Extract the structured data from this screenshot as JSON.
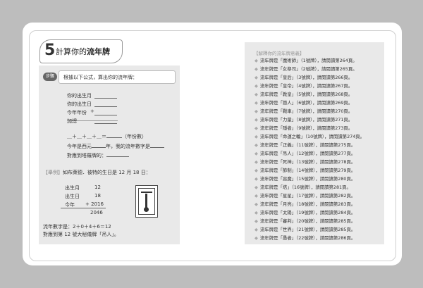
{
  "heading": {
    "number": "5",
    "text": "計算你的",
    "bold": "流年牌"
  },
  "step": {
    "badge": "步驟",
    "instruction": "根據以下公式，算出你的流年牌："
  },
  "form": {
    "birth_month": "你的出生月",
    "birth_day": "你的出生日",
    "this_year": "今年年份",
    "plus": "+",
    "add": "加總",
    "sum_formula_start": "＿＋＿＋＿＋＿＝",
    "sum_formula_end": "（年份數）",
    "result_pre": "今年是西元",
    "result_mid": "年，我的流年數字是",
    "mapping": "對應到塔羅牌的："
  },
  "example": {
    "label": "【舉例】",
    "text": "如布萊德．彼特的生日是 12 月 18 日：",
    "rows": [
      {
        "label": "出生月",
        "value": "12"
      },
      {
        "label": "出生日",
        "value": "18"
      },
      {
        "label": "今年",
        "value": "+ 2016"
      }
    ],
    "total": "2046",
    "conclusion1": "流年數字是：2＋0＋4＋6＝12",
    "conclusion2": "對應到第 12 號大秘儀牌「吊人」。"
  },
  "reference": {
    "title": "【解釋你的流年牌意義】",
    "items": [
      "流年牌是「魔術師」（1號牌），請閱讀第264頁。",
      "流年牌是「女祭司」（2號牌），請閱讀第265頁。",
      "流年牌是「皇后」（3號牌），請閱讀第266頁。",
      "流年牌是「皇帝」（4號牌），請閱讀第267頁。",
      "流年牌是「教皇」（5號牌），請閱讀第268頁。",
      "流年牌是「戀人」（6號牌），請閱讀第269頁。",
      "流年牌是「戰車」（7號牌），請閱讀第270頁。",
      "流年牌是「力量」（8號牌），請閱讀第271頁。",
      "流年牌是「隱者」（9號牌），請閱讀第273頁。",
      "流年牌是「命運之輪」（10號牌），請閱讀第274頁。",
      "流年牌是「正義」（11號牌），請閱讀第275頁。",
      "流年牌是「吊人」（12號牌），請閱讀第277頁。",
      "流年牌是「死神」（13號牌），請閱讀第278頁。",
      "流年牌是「節制」（14號牌），請閱讀第279頁。",
      "流年牌是「惡魔」（15號牌），請閱讀第280頁。",
      "流年牌是「塔」（16號牌），請閱讀第281頁。",
      "流年牌是「星星」（17號牌），請閱讀第282頁。",
      "流年牌是「月亮」（18號牌），請閱讀第283頁。",
      "流年牌是「太陽」（19號牌），請閱讀第284頁。",
      "流年牌是「審判」（20號牌），請閱讀第285頁。",
      "流年牌是「世界」（21號牌），請閱讀第285頁。",
      "流年牌是「愚者」（22號牌），請閱讀第286頁。"
    ]
  }
}
